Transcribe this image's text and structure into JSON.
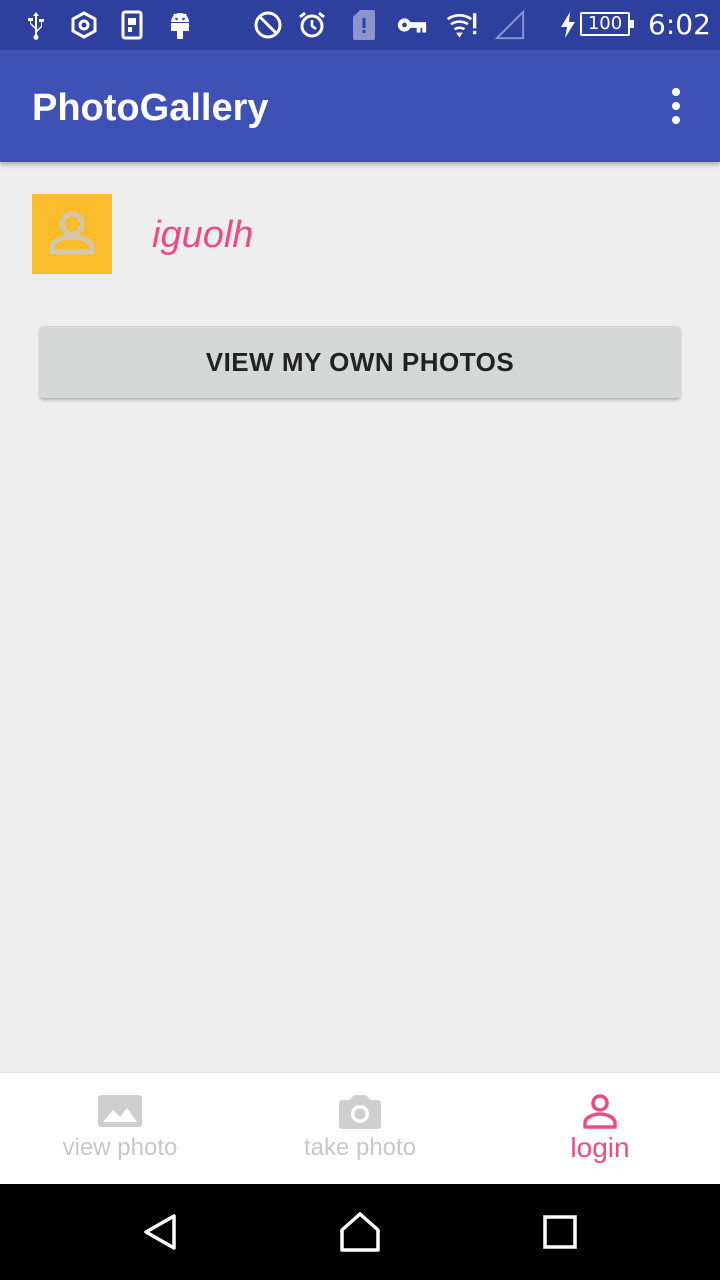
{
  "status_bar": {
    "icons": [
      "usb-icon",
      "hexagon-icon",
      "sim-card-icon",
      "android-icon",
      "do-not-disturb-icon",
      "alarm-icon",
      "sd-card-icon",
      "vpn-key-icon",
      "wifi-icon",
      "signal-icon",
      "charging-icon"
    ],
    "battery": "100",
    "time": "6:02"
  },
  "app_bar": {
    "title": "PhotoGallery",
    "menu_icon": "more-vert-icon"
  },
  "profile": {
    "avatar_icon": "person-icon",
    "username": "iguolh"
  },
  "actions": {
    "view_own_photos": "VIEW MY OWN PHOTOS"
  },
  "bottom_nav": {
    "items": [
      {
        "label": "view photo",
        "icon": "image-icon",
        "active": false
      },
      {
        "label": "take photo",
        "icon": "camera-icon",
        "active": false
      },
      {
        "label": "login",
        "icon": "person-icon",
        "active": true
      }
    ]
  },
  "system_nav": {
    "buttons": [
      "back-icon",
      "home-icon",
      "recents-icon"
    ]
  },
  "colors": {
    "primary": "#3f51b5",
    "primary_dark": "#2f3f9e",
    "accent": "#ee4a86",
    "avatar_bg": "#fbbd2c"
  }
}
